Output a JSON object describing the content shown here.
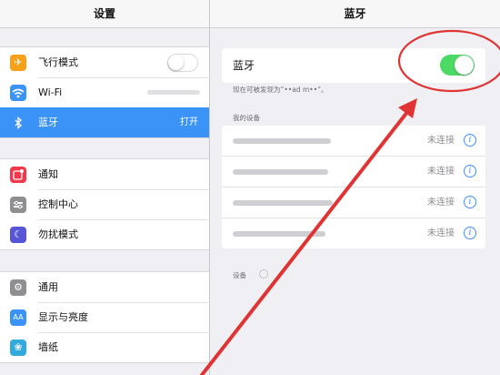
{
  "left_header": {
    "title": "设置"
  },
  "left": {
    "group1": [
      {
        "label": "飞行模式",
        "icon": "airplane-icon",
        "color": "#f7a11b",
        "toggle": "off"
      },
      {
        "label": "Wi-Fi",
        "icon": "wifi-icon",
        "color": "#3b92f7"
      },
      {
        "label": "蓝牙",
        "icon": "bluetooth-icon",
        "color": "#3b92f7",
        "value": "打开",
        "selected": true
      }
    ],
    "group2": [
      {
        "label": "通知",
        "icon": "notification-icon",
        "color": "#f2384a"
      },
      {
        "label": "控制中心",
        "icon": "control-center-icon",
        "color": "#8e8e93"
      },
      {
        "label": "勿扰模式",
        "icon": "moon-icon",
        "color": "#5856d6"
      }
    ],
    "group3": [
      {
        "label": "通用",
        "icon": "gear-icon",
        "color": "#8e8e93"
      },
      {
        "label": "显示与亮度",
        "icon": "display-icon",
        "color": "#3b92f7",
        "icon_text": "AA"
      },
      {
        "label": "墙纸",
        "icon": "wallpaper-icon",
        "color": "#33aadc"
      }
    ]
  },
  "right_header": {
    "title": "蓝牙"
  },
  "bluetooth": {
    "label": "蓝牙",
    "toggle": "on",
    "discoverable_text": "现在可被发现为“••ad m••”。"
  },
  "my_devices": {
    "header": "我的设备",
    "items": [
      {
        "status": "未连接"
      },
      {
        "status": "未连接"
      },
      {
        "status": "未连接"
      },
      {
        "status": "未连接"
      }
    ]
  },
  "other_devices": {
    "header": "设备"
  },
  "colors": {
    "accent": "#3b92f7",
    "toggle_on": "#4cd964",
    "annotation": "#e03434"
  }
}
